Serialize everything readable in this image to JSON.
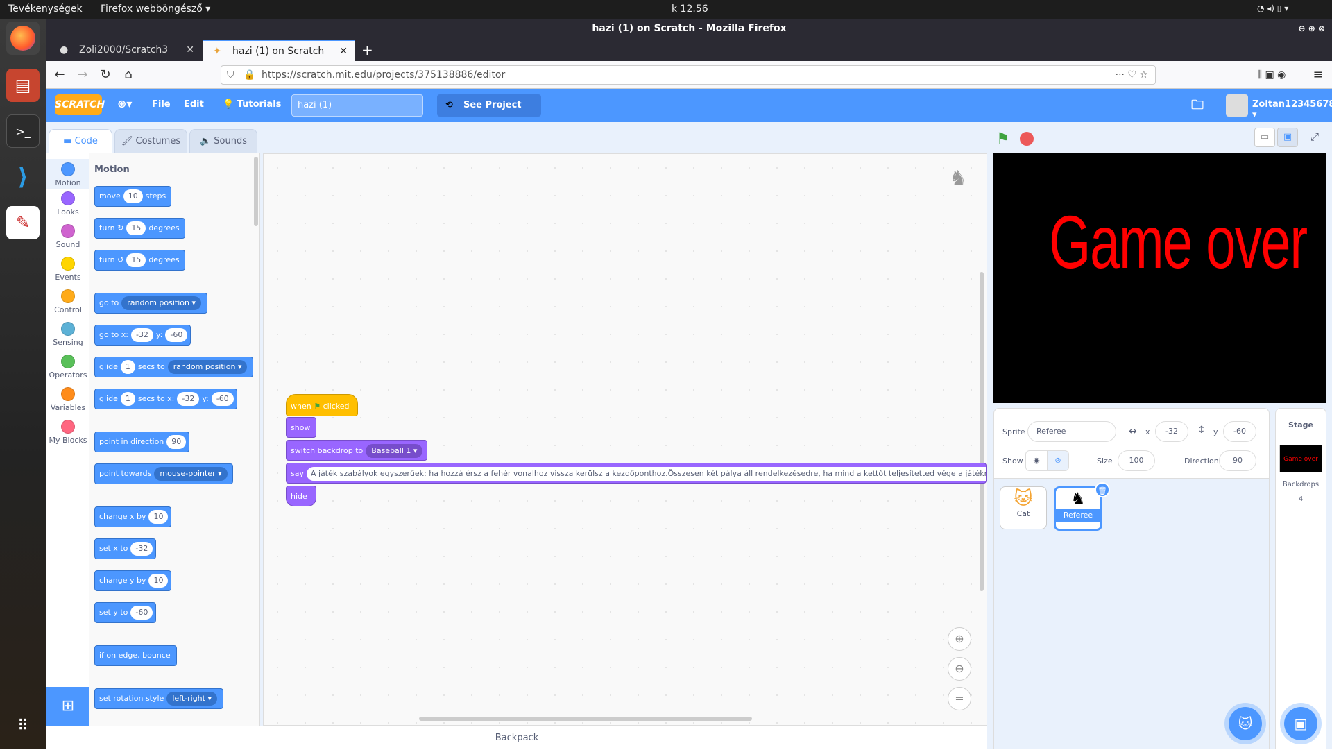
{
  "os": {
    "activities": "Tevékenységek",
    "app": "Firefox webböngésző",
    "clock": "k 12.56"
  },
  "window": {
    "title": "hazi (1) on Scratch - Mozilla Firefox"
  },
  "tabs": [
    {
      "label": "Zoli2000/Scratch3"
    },
    {
      "label": "hazi (1) on Scratch"
    }
  ],
  "url": "https://scratch.mit.edu/projects/375138886/editor",
  "menu": {
    "file": "File",
    "edit": "Edit",
    "tutorials": "Tutorials",
    "project_title": "hazi (1)",
    "see_project": "See Project Page",
    "username": "Zoltan12345678"
  },
  "editor_tabs": {
    "code": "Code",
    "costumes": "Costumes",
    "sounds": "Sounds"
  },
  "categories": [
    {
      "label": "Motion",
      "color": "#4c97ff"
    },
    {
      "label": "Looks",
      "color": "#9966ff"
    },
    {
      "label": "Sound",
      "color": "#cf63cf"
    },
    {
      "label": "Events",
      "color": "#ffd500"
    },
    {
      "label": "Control",
      "color": "#ffab19"
    },
    {
      "label": "Sensing",
      "color": "#5cb1d6"
    },
    {
      "label": "Operators",
      "color": "#59c059"
    },
    {
      "label": "Variables",
      "color": "#ff8c1a"
    },
    {
      "label": "My Blocks",
      "color": "#ff6680"
    }
  ],
  "palette": {
    "heading": "Motion",
    "move": {
      "a": "move",
      "v": "10",
      "b": "steps"
    },
    "turn_right": {
      "a": "turn",
      "v": "15",
      "b": "degrees"
    },
    "turn_left": {
      "a": "turn",
      "v": "15",
      "b": "degrees"
    },
    "goto": {
      "a": "go to",
      "dd": "random position"
    },
    "goto_xy": {
      "a": "go to x:",
      "x": "-32",
      "b": "y:",
      "y": "-60"
    },
    "glide": {
      "a": "glide",
      "v": "1",
      "b": "secs to",
      "dd": "random position"
    },
    "glide_xy": {
      "a": "glide",
      "v": "1",
      "b": "secs to x:",
      "x": "-32",
      "c": "y:",
      "y": "-60"
    },
    "point_dir": {
      "a": "point in direction",
      "v": "90"
    },
    "point_towards": {
      "a": "point towards",
      "dd": "mouse-pointer"
    },
    "change_x": {
      "a": "change x by",
      "v": "10"
    },
    "set_x": {
      "a": "set x to",
      "v": "-32"
    },
    "change_y": {
      "a": "change y by",
      "v": "10"
    },
    "set_y": {
      "a": "set y to",
      "v": "-60"
    },
    "bounce": {
      "a": "if on edge, bounce"
    },
    "rotation": {
      "a": "set rotation style",
      "dd": "left-right"
    }
  },
  "script": {
    "hat_a": "when",
    "hat_b": "clicked",
    "show": "show",
    "switch_a": "switch backdrop to",
    "switch_dd": "Baseball 1",
    "say_a": "say",
    "say_text": "A játék szabályok egyszerűek: ha hozzá érsz a fehér vonalhoz vissza kerülsz a kezdőponthoz.Összesen két pálya áll rendelkezésedre, ha mind a kettőt teljesítetted vége a játékna",
    "hide": "hide"
  },
  "backpack": "Backpack",
  "stage": {
    "text": "Game over",
    "text_color": "#ff0000"
  },
  "sprite_info": {
    "sprite_label": "Sprite",
    "name": "Referee",
    "x_label": "x",
    "x": "-32",
    "y_label": "y",
    "y": "-60",
    "show_label": "Show",
    "size_label": "Size",
    "size": "100",
    "direction_label": "Direction",
    "direction": "90"
  },
  "sprites": [
    {
      "name": "Cat"
    },
    {
      "name": "Referee"
    }
  ],
  "stage_panel": {
    "title": "Stage",
    "backdrops_label": "Backdrops",
    "backdrops_count": "4"
  }
}
